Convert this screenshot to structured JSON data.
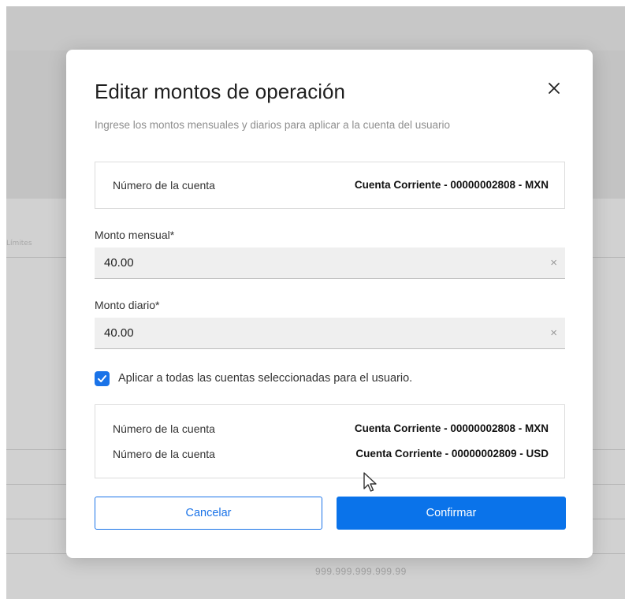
{
  "background": {
    "amount_text": "999.999.999.999.99",
    "faded_label": "Límites"
  },
  "modal": {
    "title": "Editar montos de operación",
    "subtitle": "Ingrese los montos mensuales y diarios para aplicar a la cuenta del usuario",
    "close_icon": "close-icon",
    "account": {
      "label": "Número de la cuenta",
      "value": "Cuenta Corriente - 00000002808 - MXN"
    },
    "monthly": {
      "label": "Monto mensual*",
      "value": "40.00",
      "clear": "×"
    },
    "daily": {
      "label": "Monto diario*",
      "value": "40.00",
      "clear": "×"
    },
    "apply_all": {
      "checked": true,
      "label": "Aplicar a todas las cuentas seleccionadas para el usuario."
    },
    "selected_accounts": [
      {
        "label": "Número de la cuenta",
        "value": "Cuenta Corriente - 00000002808 - MXN"
      },
      {
        "label": "Número de la cuenta",
        "value": "Cuenta Corriente - 00000002809 - USD"
      }
    ],
    "buttons": {
      "cancel": "Cancelar",
      "confirm": "Confirmar"
    }
  },
  "colors": {
    "accent": "#1a73e8",
    "confirm_bg": "#0a73ea",
    "field_bg": "#efefef"
  }
}
